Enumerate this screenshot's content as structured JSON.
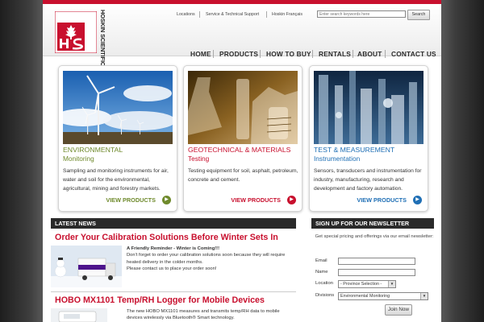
{
  "brand": {
    "name": "HOSKIN SCIENTIFIC",
    "initials": "HS",
    "color": "#c8102e"
  },
  "utility_nav": {
    "links": [
      "Locations",
      "Service & Technical Support",
      "Hoskin Français"
    ],
    "search_placeholder": "Enter search keywords here",
    "search_button": "Search"
  },
  "main_nav": {
    "items": [
      "HOME",
      "PRODUCTS",
      "HOW TO BUY",
      "RENTALS",
      "ABOUT",
      "CONTACT US"
    ]
  },
  "features": [
    {
      "title": "ENVIRONMENTAL",
      "subtitle": "Monitoring",
      "description": "Sampling and monitoring instruments for air, water and soil for the environmental, agricultural, mining and forestry markets.",
      "link": "VIEW PRODUCTS",
      "accent": "#6f8a2c",
      "image": "wind-turbines"
    },
    {
      "title": "GEOTECHNICAL & MATERIALS",
      "subtitle": "Testing",
      "description": "Testing equipment for soil, asphalt, petroleum, concrete and cement.",
      "link": "VIEW PRODUCTS",
      "accent": "#c8102e",
      "image": "lab-glassware"
    },
    {
      "title": "TEST & MEASUREMENT",
      "subtitle": "Instrumentation",
      "description": "Sensors, transducers and instrumentation for industry, manufacturing, research and development and factory automation.",
      "link": "VIEW PRODUCTS",
      "accent": "#1f6fb5",
      "image": "industrial-machinery"
    }
  ],
  "latest_news": {
    "heading": "LATEST NEWS",
    "items": [
      {
        "title": "Order Your Calibration Solutions Before Winter Sets In",
        "lead": "A Friendly Reminder -  Winter is Coming!!!",
        "body": "Don't forget to order your calibration solutions soon because they will require heated delivery in the colder months.",
        "closing": "Please contact us to place your order soon!",
        "image": "delivery-truck-snowman"
      },
      {
        "title": "HOBO MX1101 Temp/RH Logger for Mobile Devices",
        "body": "The new HOBO MX1101 measures and transmits temp/RH data to mobile devices wirelessly via Bluetooth® Smart technology.",
        "image": "data-logger"
      }
    ]
  },
  "newsletter": {
    "heading": "SIGN UP FOR OUR NEWSLETTER",
    "intro": "Get special pricing and offerings via our email newsletter:",
    "fields": {
      "email_label": "Email",
      "name_label": "Name",
      "location_label": "Location",
      "location_value": "- Province Selection -",
      "divisions_label": "Divisions",
      "divisions_value": "Environmental Monitoring"
    },
    "submit": "Join Now"
  }
}
